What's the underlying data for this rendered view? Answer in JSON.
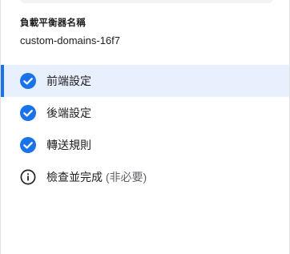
{
  "load_balancer": {
    "label": "負載平衡器名稱",
    "value": "custom-domains-16f7"
  },
  "steps": [
    {
      "label": "前端設定",
      "icon": "check-circle-icon",
      "state": "complete",
      "active": true
    },
    {
      "label": "後端設定",
      "icon": "check-circle-icon",
      "state": "complete",
      "active": false
    },
    {
      "label": "轉送規則",
      "icon": "check-circle-icon",
      "state": "complete",
      "active": false
    },
    {
      "label": "檢查並完成",
      "optional_note": "(非必要)",
      "icon": "info-icon",
      "state": "pending",
      "active": false
    }
  ],
  "colors": {
    "accent": "#1a73e8",
    "active_bg": "#e8f0fe",
    "text": "#202124",
    "muted": "#5f6368"
  }
}
